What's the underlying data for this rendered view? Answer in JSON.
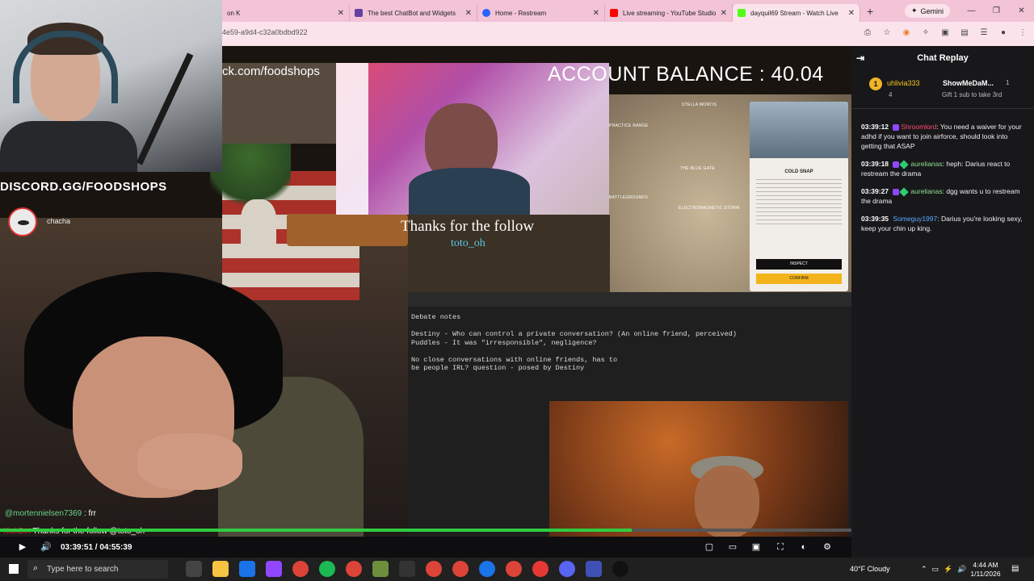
{
  "browser": {
    "tabs": [
      {
        "label": "on K",
        "color": "#e53935"
      },
      {
        "label": "The best ChatBot and Widgets",
        "color": "#6441a5"
      },
      {
        "label": "Home - Restream",
        "color": "#2962ff"
      },
      {
        "label": "Live streaming - YouTube Studio",
        "color": "#ff0000"
      },
      {
        "label": "dayquil69 Stream - Watch Live",
        "color": "#53fc18"
      }
    ],
    "new_tab": "+",
    "gemini_label": "Gemini",
    "url": "4e59-a9d4-c32a0bdbd922"
  },
  "overlays": {
    "domain_text": "ck.com/foodshops",
    "discord": "DISCORD.GG/FOODSHOPS",
    "chacha": "chacha",
    "account_balance": "ACCOUNT BALANCE : 40.04",
    "thanks_follow": "Thanks for the follow",
    "follow_user": "toto_oh",
    "mention_user": "@mortennielsen7369",
    "mention_text": ": frr",
    "thanks_line_user": "KickBot",
    "thanks_line_text": "Thanks for the follow @toto_oh"
  },
  "game_card": {
    "title": "COLD SNAP",
    "inspect": "INSPECT",
    "confirm": "CONFIRM",
    "map_labels": [
      "STELLA MONTIS",
      "PRACTICE RANGE",
      "THE BLUE GATE",
      "BATTLEGROUNDS",
      "ELECTROMAGNETIC STORM"
    ]
  },
  "editor": {
    "text": "Debate notes\n\nDestiny - Who can control a private conversation? (An online friend, perceived)\nPuddles - It was \"irresponsible\", negligence?\n\nNo close conversations with online friends, has to\nbe people IRL? question - posed by Destiny"
  },
  "player": {
    "time": "03:39:51 / 04:55:39",
    "progress": 0.742,
    "progress_color": "#2ecc40"
  },
  "chat": {
    "title": "Chat Replay",
    "gift": {
      "user1": "uhlivia333",
      "count1": "4",
      "rank": "1",
      "user2": "ShowMeDaM...",
      "count2": "1",
      "text": "Gift 1 sub to take 3rd"
    },
    "messages": [
      {
        "ts": "03:39:12",
        "user": "Shroomlord",
        "text": ": You need a waiver for your adhd if you want to join airforce, should look into getting that ASAP"
      },
      {
        "ts": "03:39:18",
        "user": "aurelianas",
        "text": ": heph: Darius react to restream the drama"
      },
      {
        "ts": "03:39:27",
        "user": "aurelianas",
        "text": ": dgg wants u to restream the drama"
      },
      {
        "ts": "03:39:35",
        "user": "Someguy1997",
        "text": ": Darius you're looking sexy, keep your chin up king."
      }
    ]
  },
  "taskbar": {
    "search_placeholder": "Type here to search",
    "weather": "40°F  Cloudy",
    "time": "4:44 AM",
    "date": "1/11/2026"
  }
}
